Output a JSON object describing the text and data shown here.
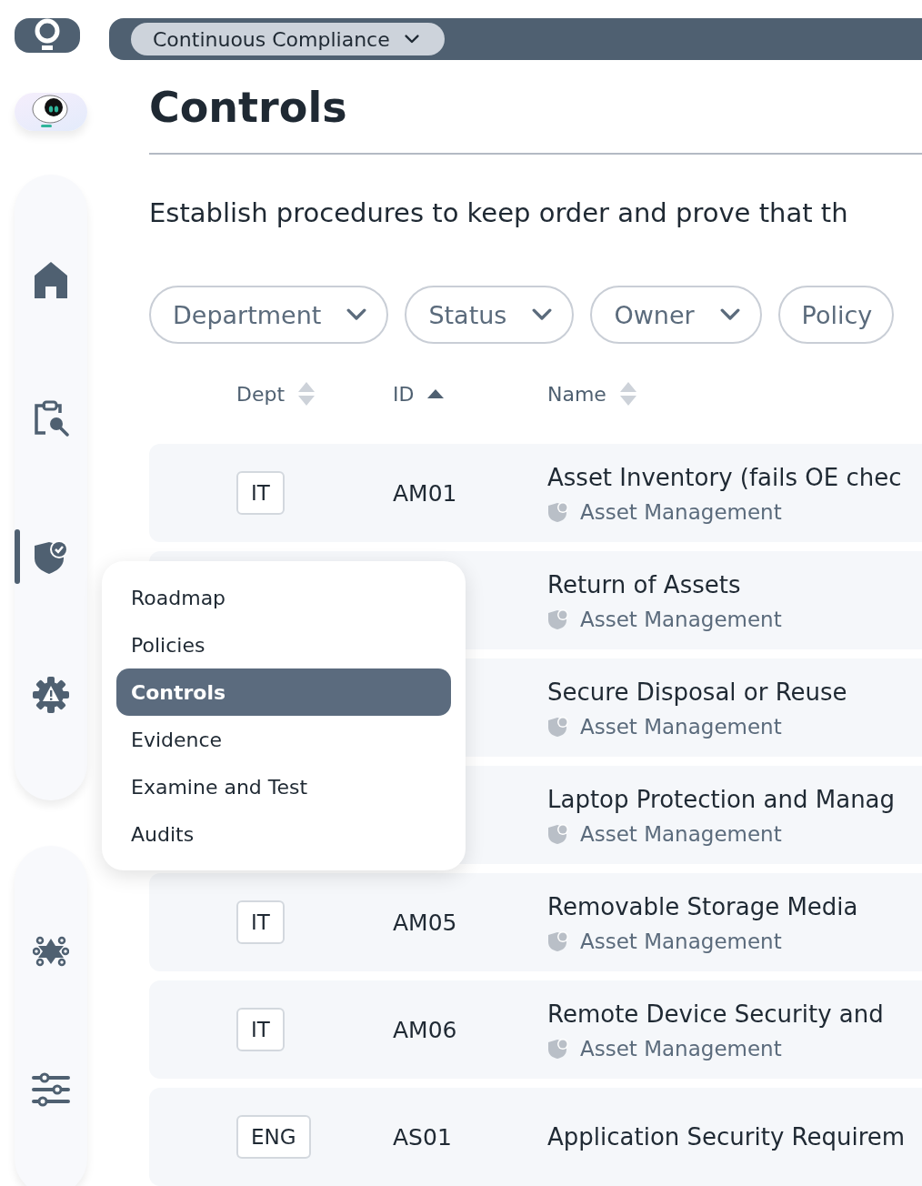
{
  "sidebar": {
    "nav_groups": [
      [
        {
          "kind": "home",
          "selected": false
        },
        {
          "kind": "audit",
          "selected": false
        },
        {
          "kind": "shield",
          "selected": true
        },
        {
          "kind": "risk",
          "selected": false
        }
      ],
      [
        {
          "kind": "network",
          "selected": false
        },
        {
          "kind": "settings",
          "selected": false
        }
      ]
    ]
  },
  "topbar": {
    "workspace": "Continuous Compliance"
  },
  "page": {
    "title": "Controls",
    "description": "Establish procedures to keep order and prove that th"
  },
  "filters": [
    "Department",
    "Status",
    "Owner",
    "Policy"
  ],
  "table": {
    "columns": [
      {
        "label": "Dept",
        "sorted": false
      },
      {
        "label": "ID",
        "sorted": true
      },
      {
        "label": "Name",
        "sorted": false
      }
    ],
    "rows": [
      {
        "dept": "IT",
        "id": "AM01",
        "name": "Asset Inventory (fails OE chec",
        "category": "Asset Management"
      },
      {
        "name": "Return of Assets",
        "category": "Asset Management"
      },
      {
        "name": "Secure Disposal or Reuse",
        "category": "Asset Management"
      },
      {
        "name": "Laptop Protection and Manag",
        "category": "Asset Management"
      },
      {
        "dept": "IT",
        "id": "AM05",
        "name": "Removable Storage Media",
        "category": "Asset Management"
      },
      {
        "dept": "IT",
        "id": "AM06",
        "name": "Remote Device Security and",
        "category": "Asset Management"
      },
      {
        "dept": "ENG",
        "id": "AS01",
        "name": "Application Security Requirem"
      }
    ]
  },
  "menu": {
    "items": [
      {
        "label": "Roadmap",
        "selected": false
      },
      {
        "label": "Policies",
        "selected": false
      },
      {
        "label": "Controls",
        "selected": true
      },
      {
        "label": "Evidence",
        "selected": false
      },
      {
        "label": "Examine and Test",
        "selected": false
      },
      {
        "label": "Audits",
        "selected": false
      }
    ]
  }
}
